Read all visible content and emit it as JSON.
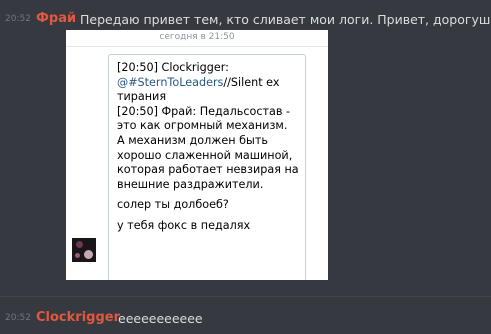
{
  "messages": [
    {
      "time": "20:52",
      "author": "Фрай",
      "text": "Передаю привет тем, кто сливает мои логи. Привет, дорогуша"
    },
    {
      "time": "20:52",
      "author": "Clockrigger",
      "text": "еееееееееее"
    }
  ],
  "attachment": {
    "date": "сегодня в 21:50",
    "lines": [
      "[20:50] Clockrigger:",
      "@#SternToLeaders//Silent ex",
      "тирания",
      "[20:50] Фрай: Педальсостав -",
      "это как огромный механизм.",
      "А механизм должен быть",
      "хорошо слаженной машиной,",
      "которая работает невзирая на",
      "внешние раздражители."
    ],
    "link_text": "@#SternToLeaders",
    "link_rest": "//Silent ex",
    "reply1": "солер ты долбоеб?",
    "reply2": "у тебя фокс в педалях"
  },
  "colors": {
    "background": "#36393f",
    "author": "#e0583f",
    "text": "#dcddde",
    "timestamp": "#72767d",
    "link": "#2a5885"
  }
}
